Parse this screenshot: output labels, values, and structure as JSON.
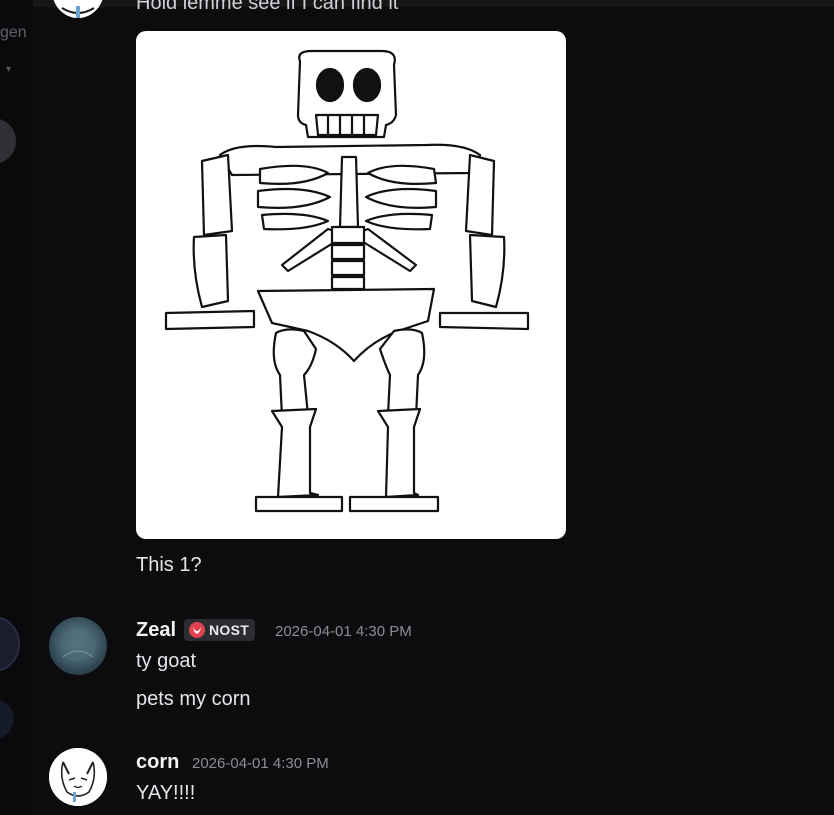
{
  "sidebar": {
    "channel_fragment": "gen",
    "mark": "▾"
  },
  "messages": {
    "top_partial_text": "Hold lemme see if I can find it",
    "attachment_icon": "skeleton-drawing",
    "this_one_text": "This 1?",
    "zeal": {
      "username": "Zeal",
      "badge_label": "NOST",
      "timestamp": "2026-04-01 4:30 PM",
      "lines": [
        "ty goat",
        "pets my corn"
      ]
    },
    "corn": {
      "username": "corn",
      "timestamp": "2026-04-01 4:30 PM",
      "lines": [
        "YAY!!!!"
      ]
    }
  },
  "colors": {
    "background": "#0c0c0e",
    "username": "#f2f3f5",
    "timestamp": "#8b8e94",
    "badge_bg": "#2b2d31",
    "badge_icon": "#e0434f"
  }
}
